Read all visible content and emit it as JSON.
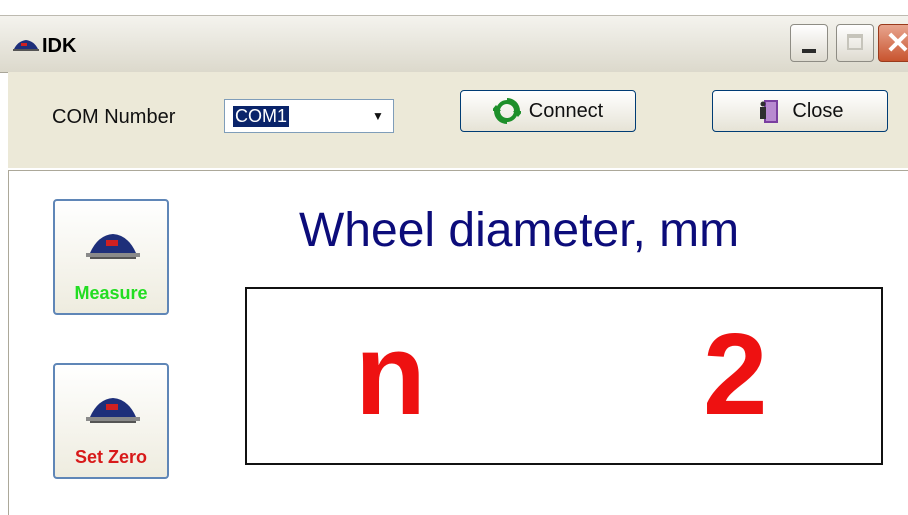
{
  "window": {
    "title": "IDK",
    "icon": "scale-icon"
  },
  "toolbar": {
    "com_label": "COM Number",
    "com_value": "COM1",
    "connect_label": "Connect",
    "close_label": "Close"
  },
  "actions": {
    "measure_label": "Measure",
    "set_zero_label": "Set Zero"
  },
  "readout": {
    "heading": "Wheel diameter, mm",
    "left_value": "n",
    "right_value": "2"
  },
  "colors": {
    "heading": "#0c0c7a",
    "readout": "#ee1111",
    "measure": "#22dd22",
    "set_zero": "#d81a1a"
  }
}
